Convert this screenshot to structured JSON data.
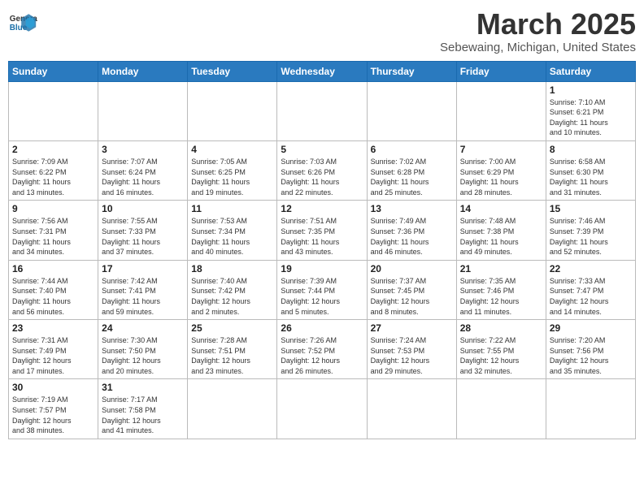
{
  "header": {
    "logo_general": "General",
    "logo_blue": "Blue",
    "title": "March 2025",
    "subtitle": "Sebewaing, Michigan, United States"
  },
  "days_of_week": [
    "Sunday",
    "Monday",
    "Tuesday",
    "Wednesday",
    "Thursday",
    "Friday",
    "Saturday"
  ],
  "weeks": [
    [
      {
        "day": "",
        "info": ""
      },
      {
        "day": "",
        "info": ""
      },
      {
        "day": "",
        "info": ""
      },
      {
        "day": "",
        "info": ""
      },
      {
        "day": "",
        "info": ""
      },
      {
        "day": "",
        "info": ""
      },
      {
        "day": "1",
        "info": "Sunrise: 7:10 AM\nSunset: 6:21 PM\nDaylight: 11 hours\nand 10 minutes."
      }
    ],
    [
      {
        "day": "2",
        "info": "Sunrise: 7:09 AM\nSunset: 6:22 PM\nDaylight: 11 hours\nand 13 minutes."
      },
      {
        "day": "3",
        "info": "Sunrise: 7:07 AM\nSunset: 6:24 PM\nDaylight: 11 hours\nand 16 minutes."
      },
      {
        "day": "4",
        "info": "Sunrise: 7:05 AM\nSunset: 6:25 PM\nDaylight: 11 hours\nand 19 minutes."
      },
      {
        "day": "5",
        "info": "Sunrise: 7:03 AM\nSunset: 6:26 PM\nDaylight: 11 hours\nand 22 minutes."
      },
      {
        "day": "6",
        "info": "Sunrise: 7:02 AM\nSunset: 6:28 PM\nDaylight: 11 hours\nand 25 minutes."
      },
      {
        "day": "7",
        "info": "Sunrise: 7:00 AM\nSunset: 6:29 PM\nDaylight: 11 hours\nand 28 minutes."
      },
      {
        "day": "8",
        "info": "Sunrise: 6:58 AM\nSunset: 6:30 PM\nDaylight: 11 hours\nand 31 minutes."
      }
    ],
    [
      {
        "day": "9",
        "info": "Sunrise: 7:56 AM\nSunset: 7:31 PM\nDaylight: 11 hours\nand 34 minutes."
      },
      {
        "day": "10",
        "info": "Sunrise: 7:55 AM\nSunset: 7:33 PM\nDaylight: 11 hours\nand 37 minutes."
      },
      {
        "day": "11",
        "info": "Sunrise: 7:53 AM\nSunset: 7:34 PM\nDaylight: 11 hours\nand 40 minutes."
      },
      {
        "day": "12",
        "info": "Sunrise: 7:51 AM\nSunset: 7:35 PM\nDaylight: 11 hours\nand 43 minutes."
      },
      {
        "day": "13",
        "info": "Sunrise: 7:49 AM\nSunset: 7:36 PM\nDaylight: 11 hours\nand 46 minutes."
      },
      {
        "day": "14",
        "info": "Sunrise: 7:48 AM\nSunset: 7:38 PM\nDaylight: 11 hours\nand 49 minutes."
      },
      {
        "day": "15",
        "info": "Sunrise: 7:46 AM\nSunset: 7:39 PM\nDaylight: 11 hours\nand 52 minutes."
      }
    ],
    [
      {
        "day": "16",
        "info": "Sunrise: 7:44 AM\nSunset: 7:40 PM\nDaylight: 11 hours\nand 56 minutes."
      },
      {
        "day": "17",
        "info": "Sunrise: 7:42 AM\nSunset: 7:41 PM\nDaylight: 11 hours\nand 59 minutes."
      },
      {
        "day": "18",
        "info": "Sunrise: 7:40 AM\nSunset: 7:42 PM\nDaylight: 12 hours\nand 2 minutes."
      },
      {
        "day": "19",
        "info": "Sunrise: 7:39 AM\nSunset: 7:44 PM\nDaylight: 12 hours\nand 5 minutes."
      },
      {
        "day": "20",
        "info": "Sunrise: 7:37 AM\nSunset: 7:45 PM\nDaylight: 12 hours\nand 8 minutes."
      },
      {
        "day": "21",
        "info": "Sunrise: 7:35 AM\nSunset: 7:46 PM\nDaylight: 12 hours\nand 11 minutes."
      },
      {
        "day": "22",
        "info": "Sunrise: 7:33 AM\nSunset: 7:47 PM\nDaylight: 12 hours\nand 14 minutes."
      }
    ],
    [
      {
        "day": "23",
        "info": "Sunrise: 7:31 AM\nSunset: 7:49 PM\nDaylight: 12 hours\nand 17 minutes."
      },
      {
        "day": "24",
        "info": "Sunrise: 7:30 AM\nSunset: 7:50 PM\nDaylight: 12 hours\nand 20 minutes."
      },
      {
        "day": "25",
        "info": "Sunrise: 7:28 AM\nSunset: 7:51 PM\nDaylight: 12 hours\nand 23 minutes."
      },
      {
        "day": "26",
        "info": "Sunrise: 7:26 AM\nSunset: 7:52 PM\nDaylight: 12 hours\nand 26 minutes."
      },
      {
        "day": "27",
        "info": "Sunrise: 7:24 AM\nSunset: 7:53 PM\nDaylight: 12 hours\nand 29 minutes."
      },
      {
        "day": "28",
        "info": "Sunrise: 7:22 AM\nSunset: 7:55 PM\nDaylight: 12 hours\nand 32 minutes."
      },
      {
        "day": "29",
        "info": "Sunrise: 7:20 AM\nSunset: 7:56 PM\nDaylight: 12 hours\nand 35 minutes."
      }
    ],
    [
      {
        "day": "30",
        "info": "Sunrise: 7:19 AM\nSunset: 7:57 PM\nDaylight: 12 hours\nand 38 minutes."
      },
      {
        "day": "31",
        "info": "Sunrise: 7:17 AM\nSunset: 7:58 PM\nDaylight: 12 hours\nand 41 minutes."
      },
      {
        "day": "",
        "info": ""
      },
      {
        "day": "",
        "info": ""
      },
      {
        "day": "",
        "info": ""
      },
      {
        "day": "",
        "info": ""
      },
      {
        "day": "",
        "info": ""
      }
    ]
  ]
}
